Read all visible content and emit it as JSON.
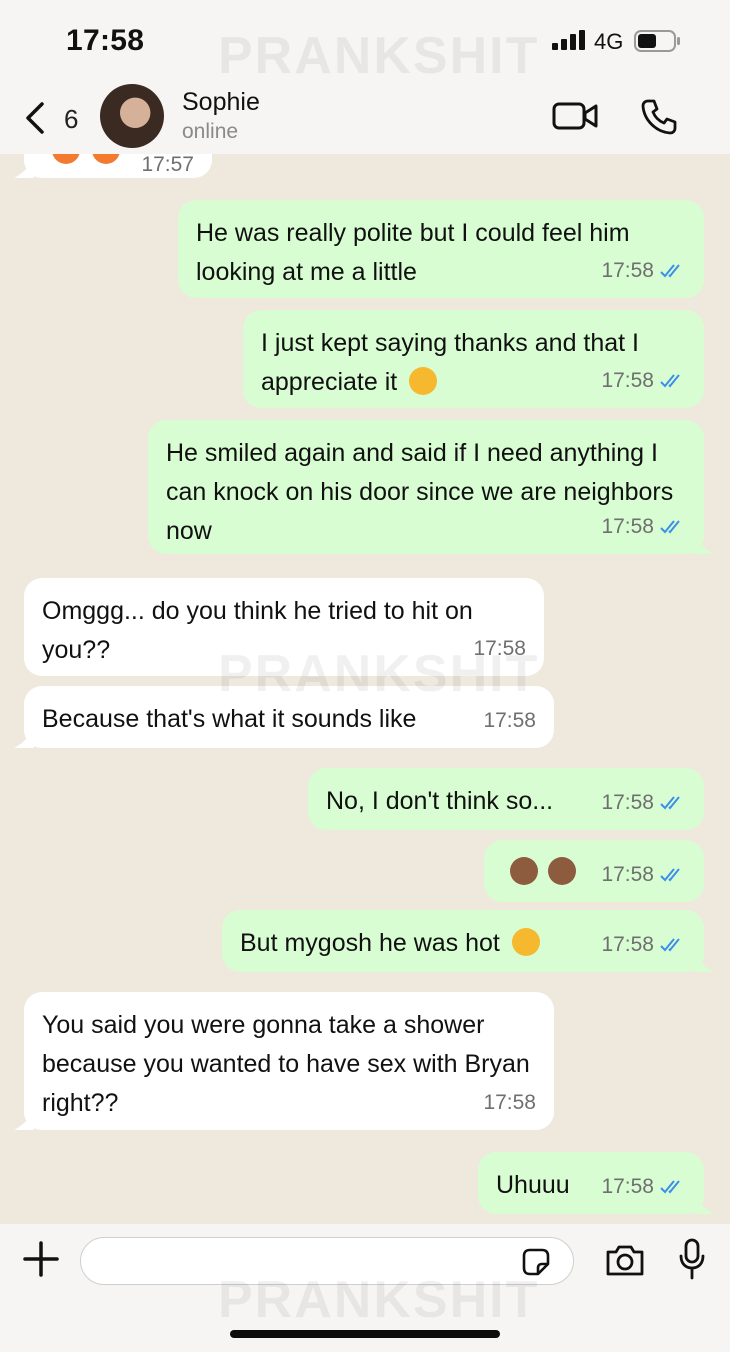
{
  "status_bar": {
    "time": "17:58",
    "network": "4G"
  },
  "watermark": "PRANKSHIT",
  "header": {
    "back_count": "6",
    "contact_name": "Sophie",
    "contact_status": "online"
  },
  "messages": [
    {
      "dir": "in",
      "text": "",
      "time": "17:57",
      "partial": true
    },
    {
      "dir": "out",
      "text": "He was really polite but I could feel him looking at me a little",
      "time": "17:58"
    },
    {
      "dir": "out",
      "text": "I just kept saying thanks and that I appreciate it",
      "emoji": "grinning-sweat-emoji",
      "time": "17:58"
    },
    {
      "dir": "out",
      "text": "He smiled again and said if I need anything I can knock on his door since we are neighbors now",
      "time": "17:58"
    },
    {
      "dir": "in",
      "text": "Omggg... do you think he tried to hit on you??",
      "time": "17:58"
    },
    {
      "dir": "in",
      "text": "Because that's what it sounds like",
      "time": "17:58"
    },
    {
      "dir": "out",
      "text": "No, I don't think so...",
      "time": "17:58"
    },
    {
      "dir": "out",
      "text": "",
      "emoji": "see-no-evil-monkey-emoji x2",
      "time": "17:58"
    },
    {
      "dir": "out",
      "text": "But mygosh he was hot",
      "emoji": "face-savoring-food-emoji",
      "time": "17:58"
    },
    {
      "dir": "in",
      "text": "You said you were gonna take a shower because you wanted to have sex with Bryan right??",
      "time": "17:58"
    },
    {
      "dir": "out",
      "text": "Uhuuu",
      "time": "17:58"
    }
  ],
  "composer": {
    "placeholder": ""
  },
  "colors": {
    "outgoing_bubble": "#d9fdd3",
    "incoming_bubble": "#ffffff",
    "read_tick": "#3a8fe8",
    "chat_background": "#eee8dd"
  }
}
